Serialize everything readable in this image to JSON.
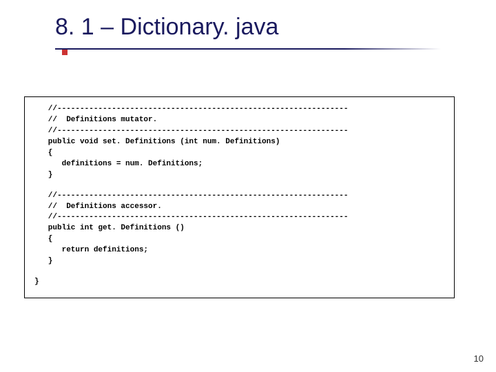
{
  "slide": {
    "title": "8. 1 – Dictionary. java",
    "page_number": "10"
  },
  "code": {
    "block1": "   //----------------------------------------------------------------\n   //  Definitions mutator.\n   //----------------------------------------------------------------\n   public void set. Definitions (int num. Definitions)\n   {\n      definitions = num. Definitions;\n   }",
    "block2": "   //----------------------------------------------------------------\n   //  Definitions accessor.\n   //----------------------------------------------------------------\n   public int get. Definitions ()\n   {\n      return definitions;\n   }",
    "closing": "}"
  }
}
